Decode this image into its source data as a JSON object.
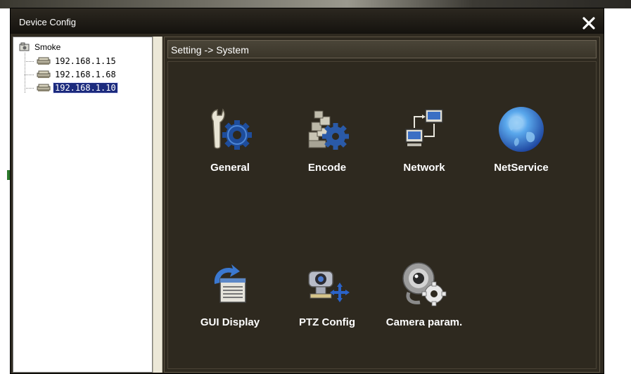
{
  "window": {
    "title": "Device Config"
  },
  "tree": {
    "root_label": "Smoke",
    "devices": [
      {
        "label": "192.168.1.15",
        "selected": false
      },
      {
        "label": "192.168.1.68",
        "selected": false
      },
      {
        "label": "192.168.1.10",
        "selected": true
      }
    ]
  },
  "main": {
    "breadcrumb": "Setting -> System",
    "items": [
      {
        "label": "General",
        "icon": "wrench-gear-icon"
      },
      {
        "label": "Encode",
        "icon": "blocks-gear-icon"
      },
      {
        "label": "Network",
        "icon": "network-computers-icon"
      },
      {
        "label": "NetService",
        "icon": "globe-icon"
      },
      {
        "label": "GUI Display",
        "icon": "gui-display-icon"
      },
      {
        "label": "PTZ Config",
        "icon": "ptz-camera-icon"
      },
      {
        "label": "Camera param.",
        "icon": "webcam-gear-icon"
      }
    ]
  },
  "colors": {
    "window_bg": "#2f2a20",
    "selection": "#1c2b7e",
    "label_text": "#ffffff"
  }
}
